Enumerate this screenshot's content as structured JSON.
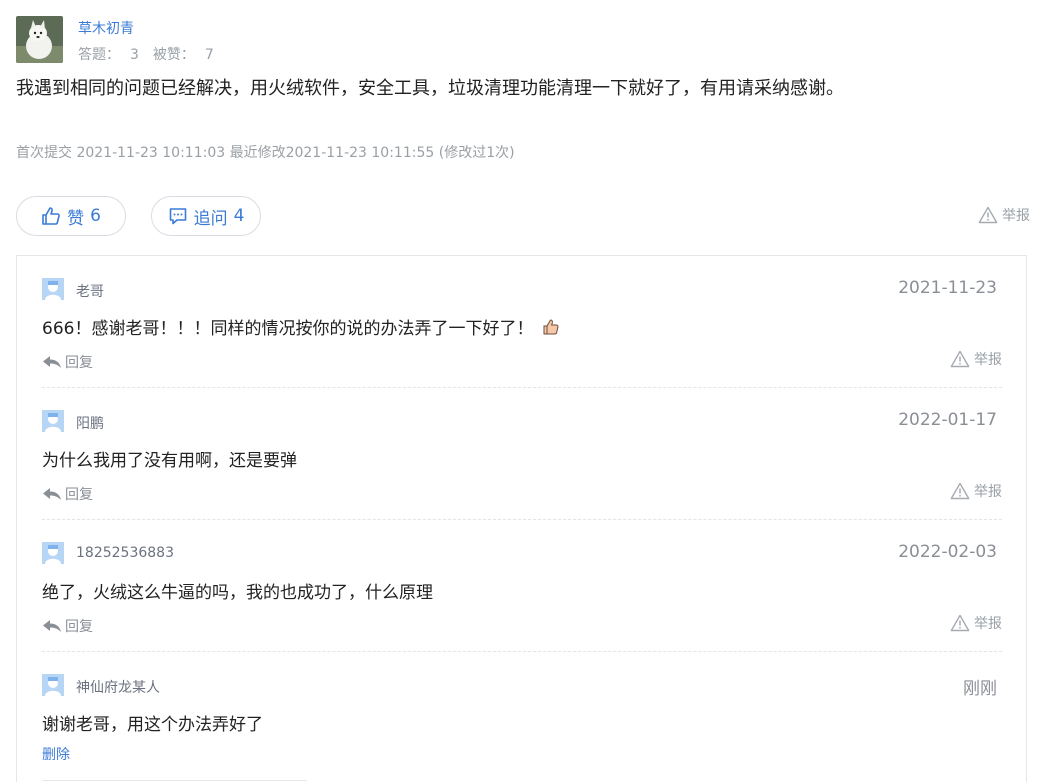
{
  "author": {
    "name": "草木初青",
    "stats_answers_label": "答题：",
    "stats_answers_value": "3",
    "stats_likes_label": "被赞：",
    "stats_likes_value": "7"
  },
  "answer": {
    "text": "我遇到相同的问题已经解决，用火绒软件，安全工具，垃圾清理功能清理一下就好了，有用请采纳感谢。",
    "meta": "首次提交 2021-11-23 10:11:03  最近修改2021-11-23 10:11:55 (修改过1次)"
  },
  "actions": {
    "like_label": "赞",
    "like_count": "6",
    "ask_label": "追问",
    "ask_count": "4",
    "report_label": "举报"
  },
  "comments": [
    {
      "name": "老哥",
      "date": "2021-11-23",
      "text": "666！感谢老哥！！！同样的情况按你的说的办法弄了一下好了！",
      "reply_label": "回复",
      "report_label": "举报"
    },
    {
      "name": "阳鹏",
      "date": "2022-01-17",
      "text": "为什么我用了没有用啊，还是要弹",
      "reply_label": "回复",
      "report_label": "举报"
    },
    {
      "name": "18252536883",
      "date": "2022-02-03",
      "text": "绝了，火绒这么牛逼的吗，我的也成功了，什么原理",
      "reply_label": "回复",
      "report_label": "举报"
    },
    {
      "name": "神仙府龙某人",
      "date": "刚刚",
      "text": "谢谢老哥，用这个办法弄好了",
      "delete_label": "删除"
    }
  ],
  "colors": {
    "accent": "#3b7bd6",
    "muted": "#9aa0a6",
    "avatar_blue": "#9cc4f2"
  },
  "icons": {
    "like": "thumbs-up-icon",
    "ask": "comment-bubble-icon",
    "report": "warning-triangle-icon",
    "reply": "reply-arrow-icon",
    "emoji": "thumbs-up-emoji-icon"
  }
}
